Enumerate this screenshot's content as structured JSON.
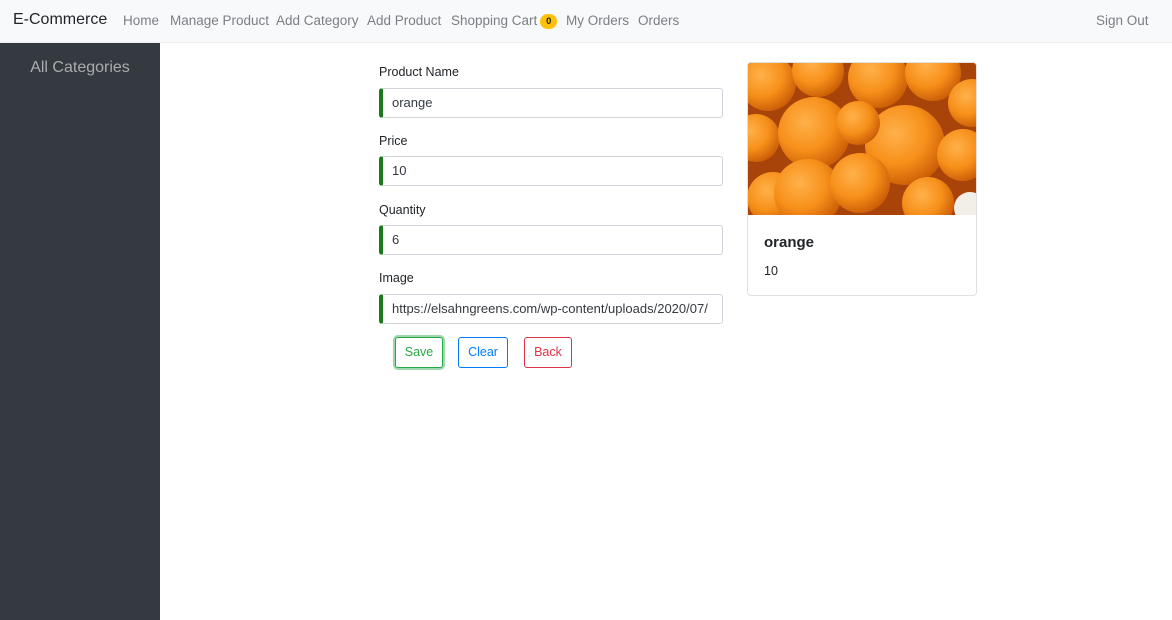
{
  "navbar": {
    "brand": "E-Commerce",
    "items": [
      {
        "label": "Home"
      },
      {
        "label": "Manage Product"
      },
      {
        "label": "Add Category"
      },
      {
        "label": "Add Product"
      },
      {
        "label": "Shopping Cart"
      },
      {
        "label": "My Orders"
      },
      {
        "label": "Orders"
      }
    ],
    "cart_count": "0",
    "sign_out": "Sign Out"
  },
  "sidebar": {
    "title": "All Categories"
  },
  "form": {
    "product_name": {
      "label": "Product Name",
      "value": "orange"
    },
    "price": {
      "label": "Price",
      "value": "10"
    },
    "quantity": {
      "label": "Quantity",
      "value": "6"
    },
    "image": {
      "label": "Image",
      "value": "https://elsahngreens.com/wp-content/uploads/2020/07/"
    },
    "buttons": {
      "save": "Save",
      "clear": "Clear",
      "back": "Back"
    }
  },
  "preview": {
    "title": "orange",
    "price": "10"
  },
  "colors": {
    "navbar_bg": "#f8f9fa",
    "sidebar_bg": "#343a40",
    "input_accent": "#1a7a1a",
    "save": "#28a745",
    "clear": "#007bff",
    "back": "#dc3545",
    "badge": "#ffc107"
  }
}
